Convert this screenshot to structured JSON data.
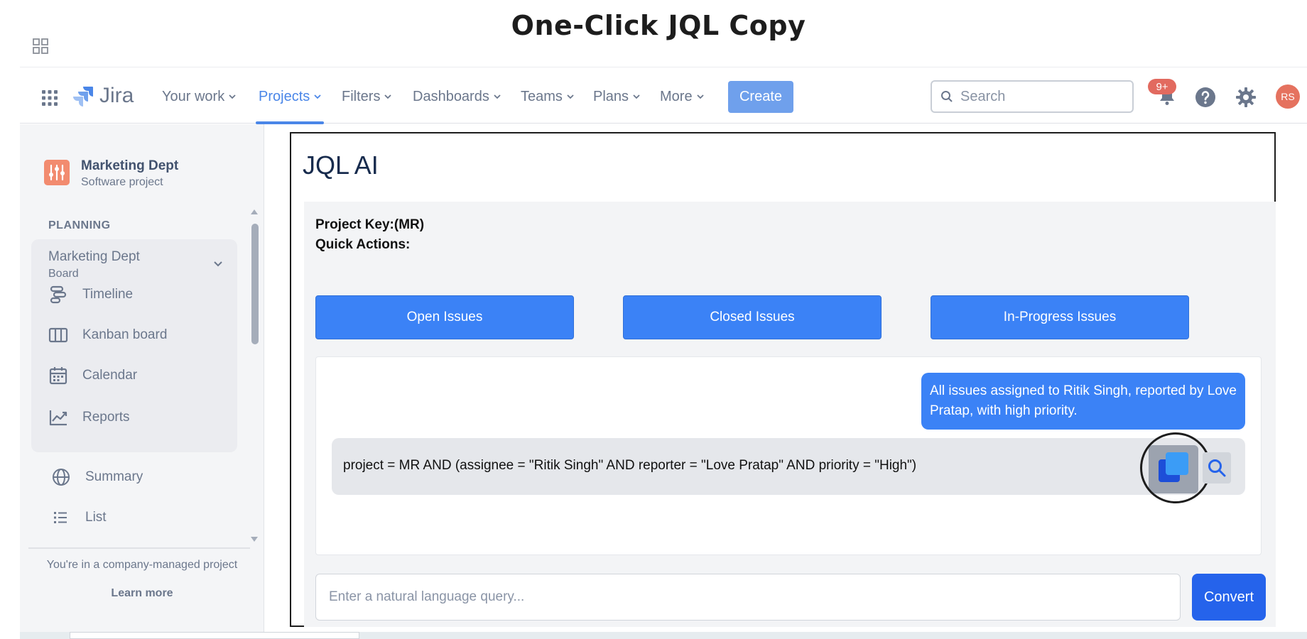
{
  "banner": {
    "title": "One-Click JQL Copy"
  },
  "nav": {
    "logo": "Jira",
    "items": [
      {
        "label": "Your work"
      },
      {
        "label": "Projects"
      },
      {
        "label": "Filters"
      },
      {
        "label": "Dashboards"
      },
      {
        "label": "Teams"
      },
      {
        "label": "Plans"
      },
      {
        "label": "More"
      }
    ],
    "active": "Projects",
    "create_label": "Create",
    "search_placeholder": "Search",
    "notification_badge": "9+",
    "avatar_initials": "RS",
    "accent_color": "#4a86e8"
  },
  "sidebar": {
    "project_name": "Marketing Dept",
    "project_type": "Software project",
    "section_label": "PLANNING",
    "board": {
      "title": "Marketing Dept",
      "subtitle": "Board"
    },
    "board_items": [
      {
        "label": "Timeline",
        "icon": "timeline-icon"
      },
      {
        "label": "Kanban board",
        "icon": "kanban-icon"
      },
      {
        "label": "Calendar",
        "icon": "calendar-icon"
      },
      {
        "label": "Reports",
        "icon": "reports-icon"
      }
    ],
    "items": [
      {
        "label": "Summary",
        "icon": "globe-icon"
      },
      {
        "label": "List",
        "icon": "list-icon"
      }
    ],
    "footer_text": "You're in a company-managed project",
    "learn_more": "Learn more"
  },
  "panel": {
    "title": "JQL AI",
    "project_key": "Project Key:(MR)",
    "quick_actions_label": "Quick Actions:",
    "quick_actions": [
      {
        "label": "Open Issues"
      },
      {
        "label": "Closed Issues"
      },
      {
        "label": "In-Progress Issues"
      }
    ],
    "user_message": "All issues assigned to Ritik Singh, reported by Love Pratap, with high priority.",
    "jql_result": "project = MR AND (assignee = \"Ritik Singh\" AND reporter = \"Love Pratap\" AND priority = \"High\")",
    "query_placeholder": "Enter a natural language query...",
    "convert_label": "Convert",
    "button_color": "#3b82f6"
  }
}
